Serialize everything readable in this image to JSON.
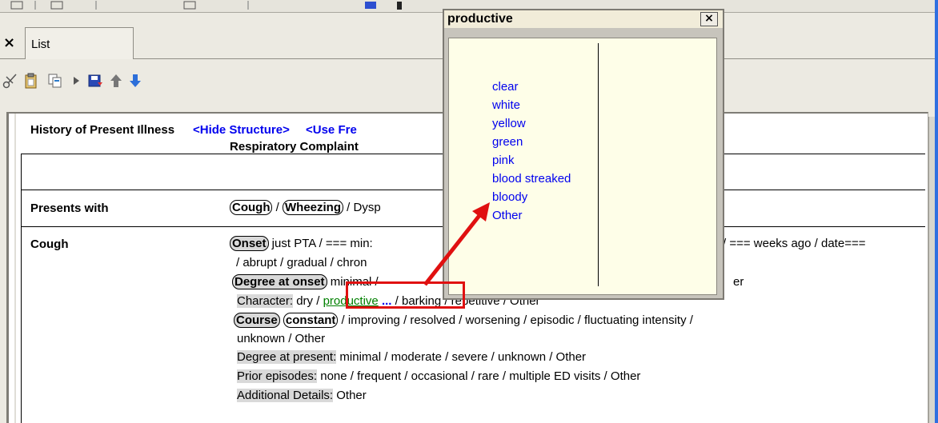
{
  "tabs": {
    "close_label": "×",
    "list_label": "List"
  },
  "toolbar": {
    "icons": [
      "scissors-icon",
      "clipboard-icon",
      "copy-icon",
      "play-icon",
      "save-icon",
      "arrow-up-icon",
      "arrow-down-icon"
    ]
  },
  "hpi": {
    "title": "History of Present Illness",
    "hide_structure": "<Hide Structure>",
    "use_free": "<Use Fre",
    "complaint": "Respiratory Complaint"
  },
  "presents_with": {
    "label": "Presents with",
    "cough": "Cough",
    "sep1": " / ",
    "wheezing": "Wheezing",
    "sep2": " / Dysp"
  },
  "cough": {
    "label": "Cough",
    "onset": "Onset",
    "onset_rest": " just PTA  /  === min:",
    "onset_tail": "/  === weeks ago  /  date===",
    "onset_line2": " / abrupt  /  gradual  /  chron",
    "degree_at_onset": "Degree at onset",
    "degree_rest": " minimal /",
    "degree_tail": "er",
    "character_label": "Character:",
    "character_dry": " dry ",
    "character_sep": "/ ",
    "character_productive": "productive",
    "character_more": "...",
    "character_rest": " /  barking  /  repetitive  /  Other",
    "course": "Course",
    "constant": "constant",
    "course_rest": " /  improving  /  resolved  /  worsening  /  episodic  /  fluctuating intensity  /",
    "course_line2": "unknown  /  Other",
    "degree_present_label": "Degree at present:",
    "degree_present_rest": "  minimal  /  moderate  /  severe  /  unknown  /  Other",
    "prior_label": "Prior episodes:",
    "prior_rest": "  none  /  frequent  /  occasional  /  rare  /  multiple ED visits  /  Other",
    "additional_label": "Additional Details:",
    "additional_rest": "  Other"
  },
  "popup": {
    "title": "productive",
    "close": "×",
    "options": [
      "clear",
      "white",
      "yellow",
      "green",
      "pink",
      "blood streaked",
      "bloody",
      "Other"
    ]
  },
  "colors": {
    "accent": "#2f6fe0",
    "link": "#0000ee",
    "selected_green": "#008000",
    "callout": "#e01010"
  }
}
